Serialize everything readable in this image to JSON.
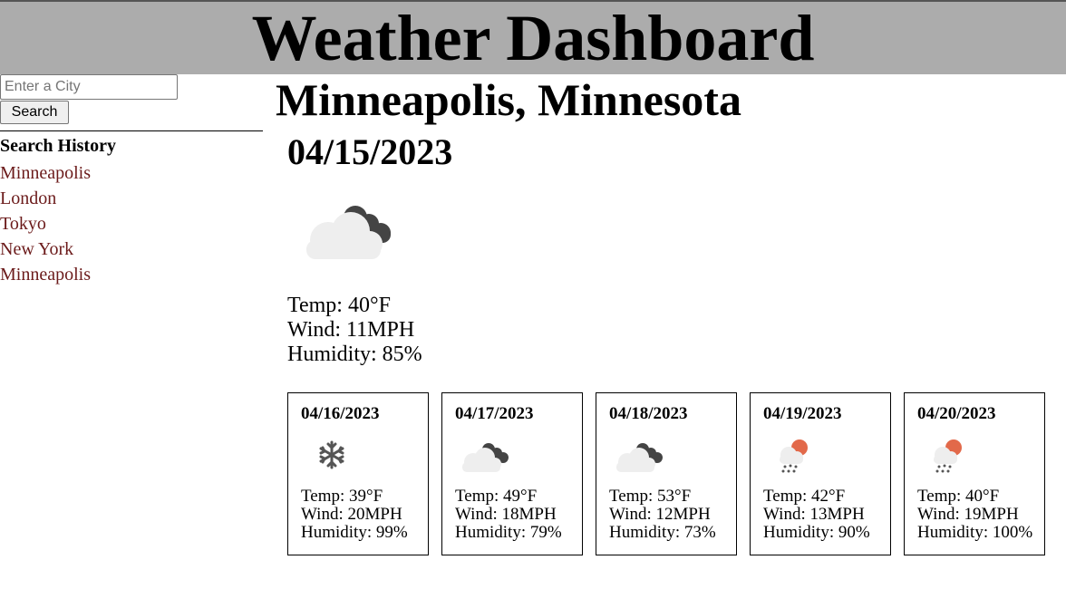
{
  "header": {
    "title": "Weather Dashboard"
  },
  "search": {
    "placeholder": "Enter a City",
    "button_label": "Search"
  },
  "history": {
    "title": "Search History",
    "items": [
      "Minneapolis",
      "London",
      "Tokyo",
      "New York",
      "Minneapolis"
    ]
  },
  "current": {
    "city": "Minneapolis, Minnesota",
    "date": "04/15/2023",
    "icon": "cloudy-icon",
    "temp": "Temp: 40°F",
    "wind": "Wind: 11MPH",
    "humidity": "Humidity: 85%"
  },
  "forecast": [
    {
      "date": "04/16/2023",
      "icon": "snowflake-icon",
      "temp": "Temp: 39°F",
      "wind": "Wind: 20MPH",
      "humidity": "Humidity: 99%"
    },
    {
      "date": "04/17/2023",
      "icon": "cloudy-icon",
      "temp": "Temp: 49°F",
      "wind": "Wind: 18MPH",
      "humidity": "Humidity: 79%"
    },
    {
      "date": "04/18/2023",
      "icon": "cloudy-icon",
      "temp": "Temp: 53°F",
      "wind": "Wind: 12MPH",
      "humidity": "Humidity: 73%"
    },
    {
      "date": "04/19/2023",
      "icon": "rain-sun-icon",
      "temp": "Temp: 42°F",
      "wind": "Wind: 13MPH",
      "humidity": "Humidity: 90%"
    },
    {
      "date": "04/20/2023",
      "icon": "rain-sun-icon",
      "temp": "Temp: 40°F",
      "wind": "Wind: 19MPH",
      "humidity": "Humidity: 100%"
    }
  ],
  "colors": {
    "header_bg": "#acacac",
    "history_link": "#6b1a1a",
    "cloud_light": "#eeeeee",
    "cloud_dark": "#444444",
    "sun": "#e2694a"
  }
}
